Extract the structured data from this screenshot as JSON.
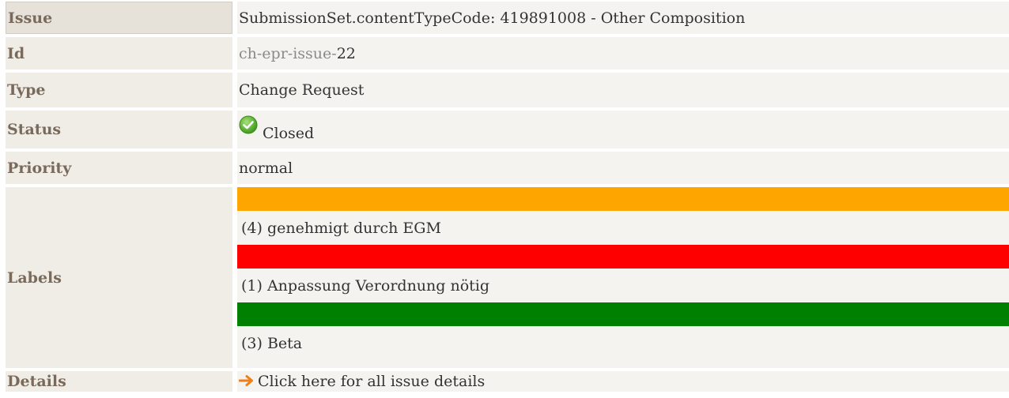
{
  "rows": {
    "issue": {
      "label": "Issue",
      "value": "SubmissionSet.contentTypeCode: 419891008 - Other Composition"
    },
    "id": {
      "label": "Id",
      "prefix": "ch-epr-issue-",
      "number": "22"
    },
    "type": {
      "label": "Type",
      "value": "Change Request"
    },
    "status": {
      "label": "Status",
      "value": "Closed",
      "icon": "check-circle-icon",
      "icon_color": "#4caf2a"
    },
    "priority": {
      "label": "Priority",
      "value": "normal"
    },
    "labels": {
      "label": "Labels",
      "items": [
        {
          "text": "(4) genehmigt durch EGM",
          "color": "#ffa500"
        },
        {
          "text": "(1) Anpassung Verordnung nötig",
          "color": "#ff0000"
        },
        {
          "text": "(3) Beta",
          "color": "#008000"
        }
      ]
    },
    "details": {
      "label": "Details",
      "link_text": "Click here for all issue details",
      "icon": "arrow-right-icon",
      "icon_color": "#f07f1a"
    }
  }
}
